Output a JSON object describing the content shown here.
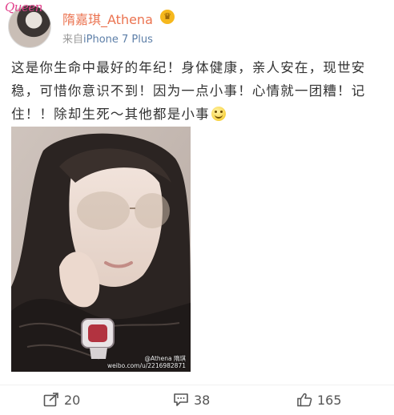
{
  "header": {
    "avatar_watermark": "Queen",
    "username": "隋嘉琪_Athena",
    "source_prefix": "来自",
    "source_device": "iPhone 7 Plus"
  },
  "post": {
    "text": "这是你生命中最好的年纪！身体健康，亲人安在，现世安稳，可惜你意识不到！因为一点小事！心情就一团糟！记住！！除却生死～其他都是小事"
  },
  "photo": {
    "watermark_line1": "@Athena 隋琪",
    "watermark_line2": "weibo.com/u/2216982871"
  },
  "actions": {
    "repost_count": "20",
    "comment_count": "38",
    "like_count": "165"
  },
  "colors": {
    "username": "#eb7350",
    "device_link": "#5d7fa8",
    "text": "#333333"
  }
}
